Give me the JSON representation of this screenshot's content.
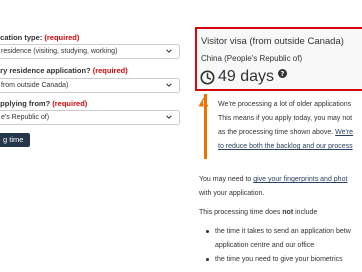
{
  "form": {
    "application_type": {
      "label": "lication type:",
      "required": "(required)",
      "value": "residence (visiting, studying, working)"
    },
    "residence_application": {
      "label": "ary residence application?",
      "required": "(required)",
      "value": "from outside Canada)"
    },
    "applying_from": {
      "label": "applying from?",
      "required": "(required)",
      "value": "e's Republic of)"
    },
    "submit_label": "g time"
  },
  "result": {
    "title": "Visitor visa (from outside Canada)",
    "country": "China (People's Republic of)",
    "processing_time": "49 days",
    "clock_icon": "clock-icon",
    "info_icon": "info-icon"
  },
  "notice": {
    "icon": "warning-icon",
    "line1": "We're processing a lot of older applications",
    "line2": "This means if you apply today, you may not",
    "line3_text": "as the processing time shown above.",
    "line3_link": "We're",
    "line4_link": "to reduce both the backlog and our process"
  },
  "details": {
    "fingerprints_prefix": "You may need to",
    "fingerprints_link": "give your fingerprints and phot",
    "fingerprints_suffix": "with your application.",
    "exclude_prefix": "This processing time does",
    "exclude_bold": "not",
    "exclude_suffix": "include",
    "bullets": [
      "the time it takes to send an application betw",
      "application centre and our office",
      "the time you need to give your biometrics"
    ]
  },
  "colors": {
    "required": "#d3080c",
    "button_bg": "#26374a",
    "link": "#284162",
    "warning": "#ee7100",
    "result_border": "#d3080c"
  }
}
